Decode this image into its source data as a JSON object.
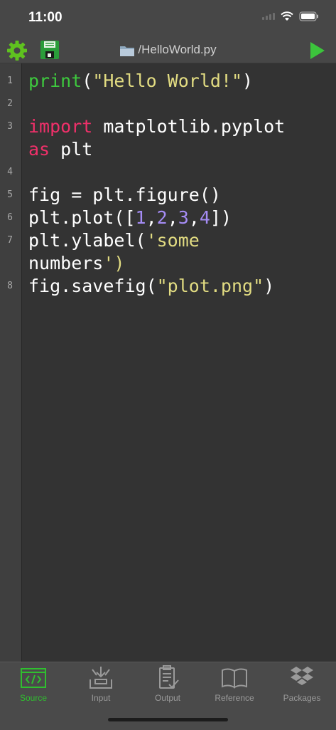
{
  "status": {
    "time": "11:00"
  },
  "toolbar": {
    "settings_icon": "gear-icon",
    "save_icon": "floppy-disk-icon",
    "file_title": "/HelloWorld.py",
    "run_icon": "play-icon"
  },
  "code": {
    "line_numbers": [
      "1",
      "2",
      "3",
      "4",
      "5",
      "6",
      "7",
      "8"
    ],
    "lines": [
      "print(\"Hello World!\")",
      "",
      "import matplotlib.pyplot",
      "as plt",
      "",
      "fig = plt.figure()",
      "plt.plot([1,2,3,4])",
      "plt.ylabel('some",
      "numbers')",
      "fig.savefig(\"plot.png\")"
    ]
  },
  "tabs": [
    {
      "label": "Source",
      "icon": "code-icon",
      "active": true
    },
    {
      "label": "Input",
      "icon": "input-icon",
      "active": false
    },
    {
      "label": "Output",
      "icon": "clipboard-icon",
      "active": false
    },
    {
      "label": "Reference",
      "icon": "book-icon",
      "active": false
    },
    {
      "label": "Packages",
      "icon": "dropbox-icon",
      "active": false
    }
  ],
  "colors": {
    "active_tab": "#2fbf2f",
    "inactive_tab": "#9a9a9a",
    "keyword": "#f0306a",
    "builtin": "#3ec93e",
    "string": "#e2dc82",
    "number": "#a58cf5"
  }
}
